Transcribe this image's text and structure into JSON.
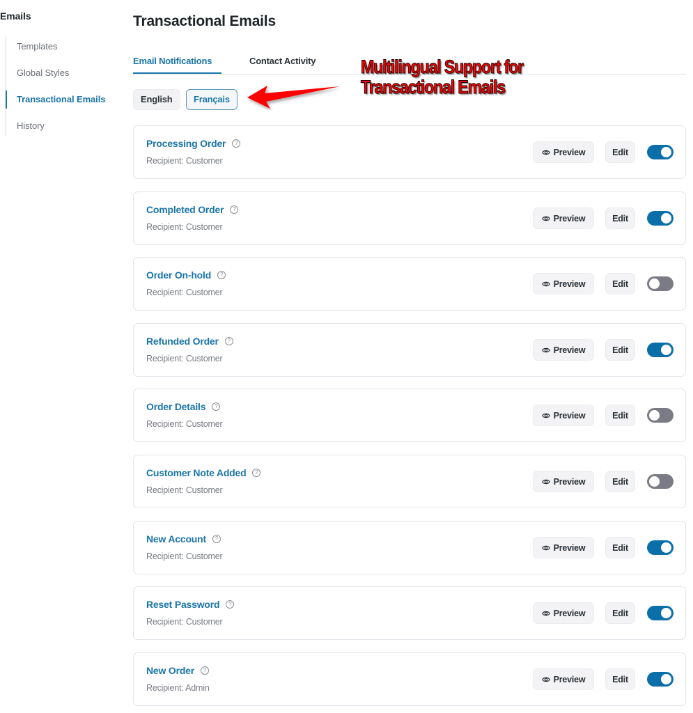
{
  "sidebar": {
    "title": "Emails",
    "items": [
      {
        "label": "Templates",
        "active": false
      },
      {
        "label": "Global Styles",
        "active": false
      },
      {
        "label": "Transactional Emails",
        "active": true
      },
      {
        "label": "History",
        "active": false
      }
    ]
  },
  "header": {
    "title": "Transactional Emails"
  },
  "tabs": [
    {
      "label": "Email Notifications",
      "active": true
    },
    {
      "label": "Contact Activity",
      "active": false
    }
  ],
  "languages": [
    {
      "label": "English",
      "active": false
    },
    {
      "label": "Français",
      "active": true
    }
  ],
  "annotation": {
    "line1": "Multilingual Support for",
    "line2": "Transactional Emails",
    "color": "#ff0000"
  },
  "actions": {
    "preview_label": "Preview",
    "preview_icon": "eye-icon",
    "edit_label": "Edit",
    "help_icon": "help-circle-icon"
  },
  "emails": [
    {
      "title": "Processing Order",
      "recipient": "Recipient: Customer",
      "enabled": true
    },
    {
      "title": "Completed Order",
      "recipient": "Recipient: Customer",
      "enabled": true
    },
    {
      "title": "Order On-hold",
      "recipient": "Recipient: Customer",
      "enabled": false
    },
    {
      "title": "Refunded Order",
      "recipient": "Recipient: Customer",
      "enabled": true
    },
    {
      "title": "Order Details",
      "recipient": "Recipient: Customer",
      "enabled": false
    },
    {
      "title": "Customer Note Added",
      "recipient": "Recipient: Customer",
      "enabled": false
    },
    {
      "title": "New Account",
      "recipient": "Recipient: Customer",
      "enabled": true
    },
    {
      "title": "Reset Password",
      "recipient": "Recipient: Customer",
      "enabled": true
    },
    {
      "title": "New Order",
      "recipient": "Recipient: Admin",
      "enabled": true
    }
  ],
  "colors": {
    "accent": "#1a75a8",
    "toggle_on": "#0a6fa8",
    "toggle_off": "#7b7b85"
  }
}
